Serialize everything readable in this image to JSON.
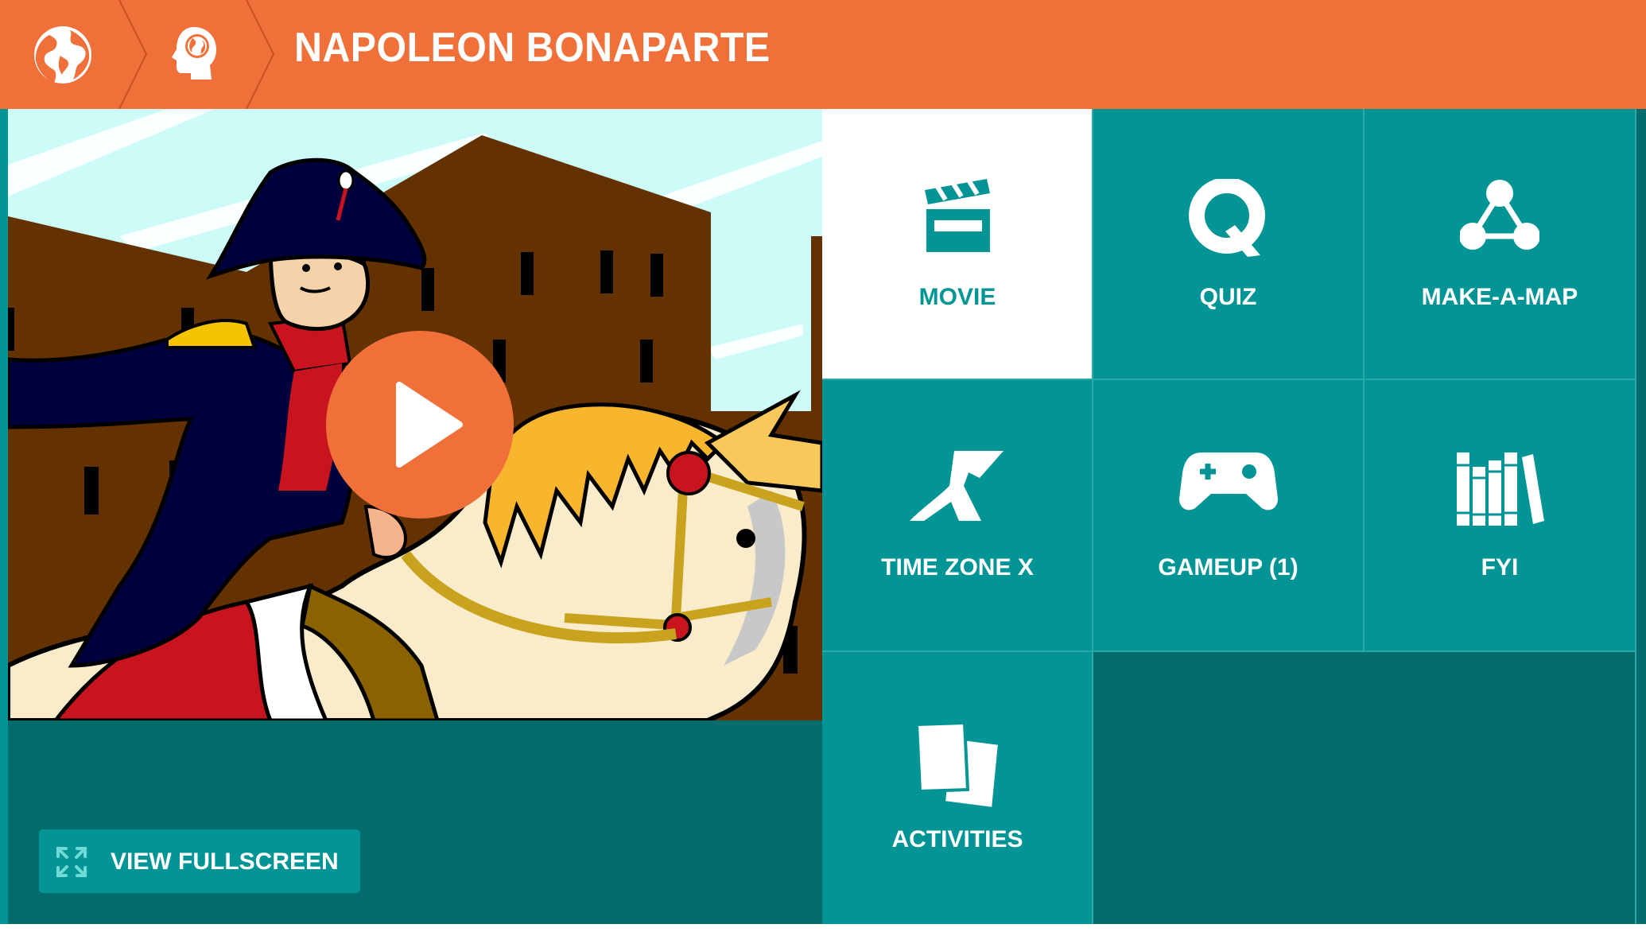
{
  "header": {
    "title": "NAPOLEON BONAPARTE",
    "breadcrumb": [
      {
        "icon": "globe-icon"
      },
      {
        "icon": "head-globe-icon"
      }
    ]
  },
  "video": {
    "play_icon": "play-icon",
    "fullscreen_label": "VIEW FULLSCREEN",
    "fullscreen_icon": "expand-icon"
  },
  "tiles": [
    {
      "label": "MOVIE",
      "icon": "clapperboard-icon",
      "active": true
    },
    {
      "label": "QUIZ",
      "icon": "quiz-icon",
      "active": false
    },
    {
      "label": "MAKE-A-MAP",
      "icon": "concept-map-icon",
      "active": false
    },
    {
      "label": "TIME ZONE X",
      "icon": "time-zone-x-icon",
      "active": false
    },
    {
      "label": "GAMEUP (1)",
      "icon": "gamepad-icon",
      "active": false
    },
    {
      "label": "FYI",
      "icon": "books-icon",
      "active": false
    },
    {
      "label": "ACTIVITIES",
      "icon": "papers-icon",
      "active": false
    }
  ],
  "colors": {
    "header_orange": "#f07039",
    "teal": "#039595",
    "dark_teal": "#046c6c",
    "white": "#ffffff"
  }
}
